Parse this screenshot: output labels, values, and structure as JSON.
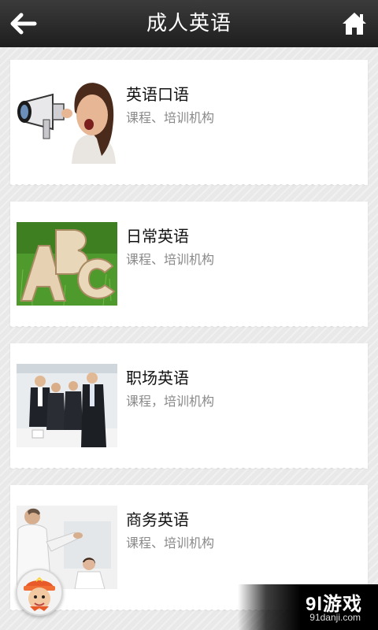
{
  "header": {
    "title": "成人英语",
    "back_icon": "arrow-left-icon",
    "home_icon": "home-icon"
  },
  "items": [
    {
      "title": "英语口语",
      "subtitle": "课程、培训机构",
      "image": "woman-megaphone-photo"
    },
    {
      "title": "日常英语",
      "subtitle": "课程、培训机构",
      "image": "abc-letters-grass-photo"
    },
    {
      "title": "职场英语",
      "subtitle": "课程，培训机构",
      "image": "business-people-photo"
    },
    {
      "title": "商务英语",
      "subtitle": "课程、培训机构",
      "image": "business-meeting-photo"
    }
  ],
  "watermark": {
    "logo": "9l游戏",
    "domain": "91danji.com"
  }
}
